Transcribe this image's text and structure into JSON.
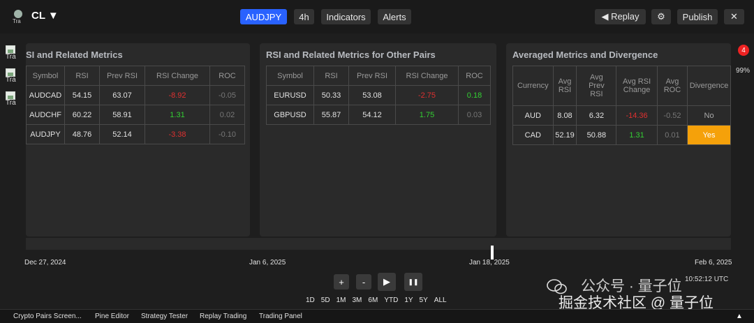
{
  "header": {
    "logo_text": "Tra",
    "symbol": "CL ▼",
    "pair": "AUDJPY",
    "interval": "4h",
    "indicators": "Indicators",
    "alerts": "Alerts",
    "replay": "◀ Replay",
    "settings_icon": "⚙",
    "publish": "Publish",
    "close_icon": "✕"
  },
  "sidebar": {
    "items": [
      "Tra",
      "Tra",
      "Tra"
    ]
  },
  "panel1": {
    "title": "SI and Related Metrics",
    "headers": [
      "Symbol",
      "RSI",
      "Prev RSI",
      "RSI Change",
      "ROC"
    ],
    "rows": [
      [
        "AUDCAD",
        "54.15",
        "63.07",
        "-8.92",
        "-0.05"
      ],
      [
        "AUDCHF",
        "60.22",
        "58.91",
        "1.31",
        "0.02"
      ],
      [
        "AUDJPY",
        "48.76",
        "52.14",
        "-3.38",
        "-0.10"
      ]
    ]
  },
  "panel2": {
    "title": "RSI and Related Metrics for Other Pairs",
    "headers": [
      "Symbol",
      "RSI",
      "Prev RSI",
      "RSI Change",
      "ROC"
    ],
    "rows": [
      [
        "EURUSD",
        "50.33",
        "53.08",
        "-2.75",
        "0.18"
      ],
      [
        "GBPUSD",
        "55.87",
        "54.12",
        "1.75",
        "0.03"
      ]
    ]
  },
  "panel3": {
    "title": "Averaged Metrics and Divergence",
    "headers": [
      "Currency",
      "Avg\nRSI",
      "Avg\nPrev\nRSI",
      "Avg RSI\nChange",
      "Avg\nROC",
      "Divergence"
    ],
    "rows": [
      [
        "AUD",
        "8.08",
        "6.32",
        "-14.36",
        "-0.52",
        "No"
      ],
      [
        "CAD",
        "52.19",
        "50.88",
        "1.31",
        "0.01",
        "Yes"
      ]
    ]
  },
  "badge": {
    "count": "4",
    "percent": "99%"
  },
  "timeline": {
    "ticks": [
      "Dec 27, 2024",
      "Jan 6, 2025",
      "Jan 18, 2025",
      "Feb 6, 2025"
    ]
  },
  "controls": {
    "plus": "+",
    "minus": "-",
    "play": "▶",
    "pause": "❚❚"
  },
  "ranges": [
    "1D",
    "5D",
    "1M",
    "3M",
    "6M",
    "YTD",
    "1Y",
    "5Y",
    "ALL"
  ],
  "clock": "10:52:12 UTC",
  "bottom_tabs": [
    "Crypto Pairs Screen...",
    "Pine Editor",
    "Strategy Tester",
    "Replay Trading",
    "Trading Panel"
  ],
  "bottom_arrow": "▲",
  "watermark": {
    "line1": "公众号 · 量子位",
    "line2": "掘金技术社区 @ 量子位"
  },
  "colors": {
    "accent": "#2962ff",
    "negative": "#e03030",
    "positive": "#33d033",
    "divergence_yes": "#f5a10a",
    "badge": "#ee2222"
  }
}
